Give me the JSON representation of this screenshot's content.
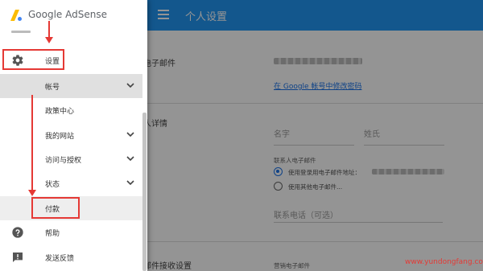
{
  "header": {
    "title": "个人设置"
  },
  "main": {
    "email_section_title": "电子邮件",
    "change_password_link": "在 Google 帐号中修改密码",
    "personal_section_title": "人详情",
    "first_name_label": "名字",
    "last_name_label": "姓氏",
    "contact_email_label": "联系人电子邮件",
    "radio_login_email": "使用登录用电子邮件地址：",
    "radio_other_email": "使用其他电子邮件...",
    "phone_label": "联系电话（可选）",
    "receive_section_title": "邮件接收设置",
    "marketing_email_label": "营销电子邮件"
  },
  "drawer": {
    "logo_text": "Google AdSense",
    "items": [
      {
        "label": "设置",
        "icon": "gear-icon"
      },
      {
        "label": "帐号",
        "icon": "chevron-down-icon"
      },
      {
        "label": "政策中心"
      },
      {
        "label": "我的网站",
        "icon": "chevron-down-icon"
      },
      {
        "label": "访问与授权",
        "icon": "chevron-down-icon"
      },
      {
        "label": "状态",
        "icon": "chevron-down-icon"
      },
      {
        "label": "付款"
      },
      {
        "label": "帮助",
        "icon": "help-icon"
      },
      {
        "label": "发送反馈",
        "icon": "feedback-icon"
      }
    ]
  },
  "watermark": "www.yundongfang.com",
  "colors": {
    "brand_blue": "#2196f3",
    "annotation_red": "#e53935",
    "link_blue": "#1a73e8"
  }
}
